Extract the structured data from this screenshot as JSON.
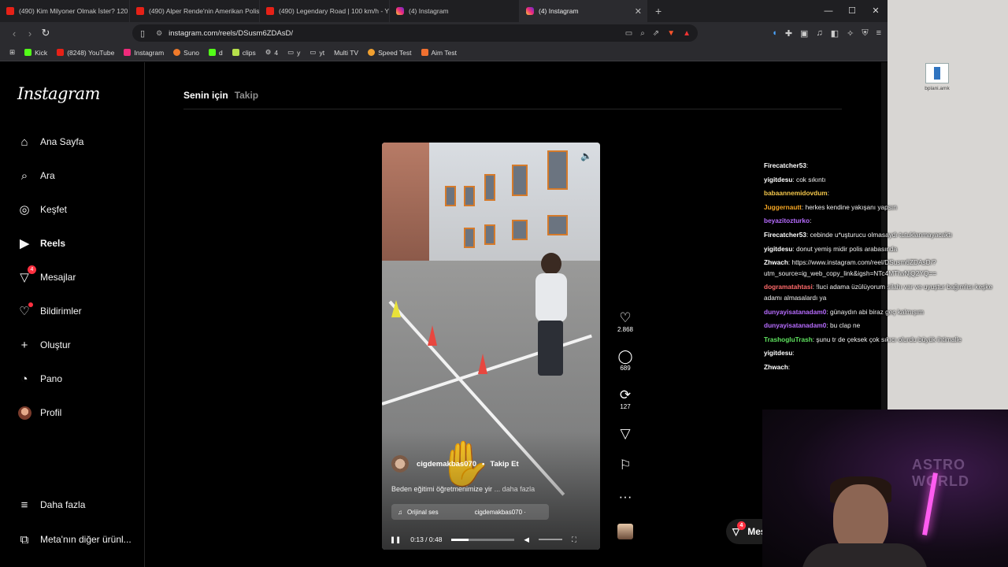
{
  "tabs": [
    {
      "label": "(490) Kim Milyoner Olmak İster? 120",
      "icon": "youtube"
    },
    {
      "label": "(490) Alper Rende'nin Amerikan Polis",
      "icon": "youtube"
    },
    {
      "label": "(490) Legendary Road | 100 km/h - Y",
      "icon": "youtube"
    },
    {
      "label": "(4) Instagram",
      "icon": "instagram"
    },
    {
      "label": "(4) Instagram",
      "icon": "instagram",
      "active": true
    }
  ],
  "address": {
    "url": "instagram.com/reels/DSusm6ZDAsD/"
  },
  "bookmarks": [
    "Kick",
    "(8248) YouTube",
    "Instagram",
    "Suno",
    "d",
    "clips",
    "4",
    "y",
    "yt",
    "Multi TV",
    "Speed Test",
    "Aim Test"
  ],
  "instagram": {
    "logo": "Instagram",
    "nav": [
      {
        "label": "Ana Sayfa",
        "icon": "home-icon"
      },
      {
        "label": "Ara",
        "icon": "search-icon"
      },
      {
        "label": "Keşfet",
        "icon": "compass-icon"
      },
      {
        "label": "Reels",
        "icon": "reels-icon"
      },
      {
        "label": "Mesajlar",
        "icon": "messenger-icon",
        "badge": "4"
      },
      {
        "label": "Bildirimler",
        "icon": "heart-icon"
      },
      {
        "label": "Oluştur",
        "icon": "plus-icon"
      },
      {
        "label": "Pano",
        "icon": "dashboard-icon"
      },
      {
        "label": "Profil",
        "icon": "avatar"
      }
    ],
    "more": "Daha fazla",
    "meta": "Meta'nın diğer ürünl...",
    "feed_tabs": {
      "for_you": "Senin için",
      "following": "Takip"
    },
    "reel": {
      "author": "cigdemakbas070",
      "follow": "Takip Et",
      "separator": "•",
      "caption": "Beden eğitimi öğretmenimize yir",
      "caption_more": "... daha fazla",
      "audio_label": "Orijinal ses",
      "audio_author": "cigdemakbas070 ·",
      "time": "0:13 / 0:48",
      "progress": 0.27
    },
    "actions": {
      "likes": "2.868",
      "comments": "689",
      "reposts": "127"
    },
    "messages_pill": {
      "label": "Mes",
      "badge": "4"
    }
  },
  "desktop_icon": "bplani.amk",
  "chat": [
    {
      "user": "Firecatcher53",
      "color": "#ffffff",
      "text": ""
    },
    {
      "user": "yigitdesu",
      "color": "#ffffff",
      "text": "cok sıkıntı"
    },
    {
      "user": "babaannemidovdum",
      "color": "#f5c84b",
      "text": ""
    },
    {
      "user": "Juggernautt",
      "color": "#f5a623",
      "text": "herkes kendine yakışanı yapsın"
    },
    {
      "user": "beyazitozturko",
      "color": "#b76cff",
      "text": ""
    },
    {
      "user": "Firecatcher53",
      "color": "#ffffff",
      "text": "cebinde u*uşturucu olmasaydı tutuklanmayacaktı"
    },
    {
      "user": "yigitdesu",
      "color": "#ffffff",
      "text": "donut yemiş midir polis arabasında"
    },
    {
      "user": "Zhwach",
      "color": "#ffffff",
      "text": "https://www.instagram.com/reel/DSusm6ZDAsD/?utm_source=ig_web_copy_link&igsh=NTc4MTIwNjQ2YQ=="
    },
    {
      "user": "dogramatahtasi",
      "color": "#ff6a6a",
      "text": "!luci adama üzülüyorum silahı var ve uyuştur bağımlısı keşke adamı almasalardı ya"
    },
    {
      "user": "dunyayisatanadam0",
      "color": "#b76cff",
      "text": "günaydın abi biraz geç kalmışım"
    },
    {
      "user": "dunyayisatanadam0",
      "color": "#b76cff",
      "text": "bu clap ne"
    },
    {
      "user": "TrashogluTrash",
      "color": "#5fe35f",
      "text": "şunu tr de çeksek çok sıkıcı olurdu büyük ihtimalle"
    },
    {
      "user": "yigitdesu",
      "color": "#ffffff",
      "text": ""
    },
    {
      "user": "Zhwach",
      "color": "#ffffff",
      "text": ""
    }
  ],
  "colors": {
    "accent": "#ff3040",
    "bg": "#000000",
    "chrome": "#2b2b2f"
  }
}
